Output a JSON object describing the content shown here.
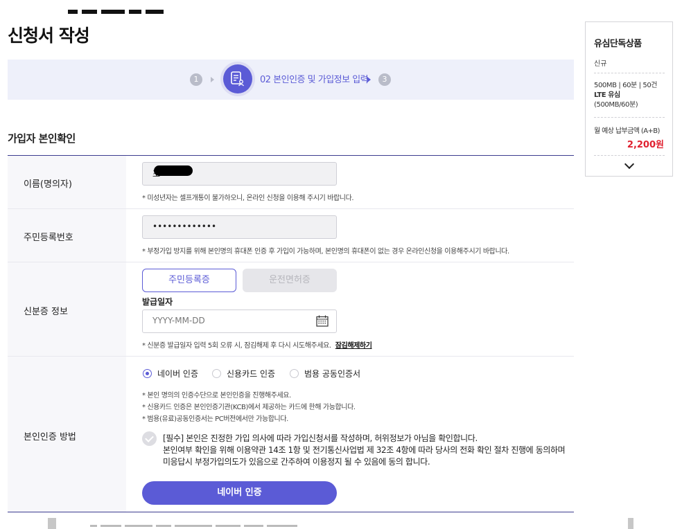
{
  "page": {
    "title": "신청서 작성"
  },
  "steps": {
    "step1": "1",
    "current_label": "02 본인인증 및 가입정보 입력",
    "step3": "3"
  },
  "section": {
    "title": "가입자 본인확인"
  },
  "rows": {
    "name": {
      "label": "이름(명의자)",
      "value": "조",
      "note": "* 미성년자는 셀프개통이 불가하오니, 온라인 신청을 이용해 주시기 바랍니다."
    },
    "rrn": {
      "label": "주민등록번호",
      "value": "•••••••••••••",
      "note": "* 부정가입 방지를 위해 본인명의 휴대폰 인증 후 가입이 가능하며, 본인명의 휴대폰이 없는 경우 온라인신청을 이용해주시기 바랍니다."
    },
    "id": {
      "label": "신분증 정보",
      "btn_resident": "주민등록증",
      "btn_license": "운전면허증",
      "issue_date_label": "발급일자",
      "issue_date_placeholder": "YYYY-MM-DD",
      "note": "* 신분증 발급일자 입력 5회 오류 시, 잠김해제 후 다시 시도해주세요.",
      "unlock_link": "잠김해제하기"
    },
    "auth": {
      "label": "본인인증 방법",
      "options": [
        "네이버 인증",
        "신용카드 인증",
        "범용 공동인증서"
      ],
      "selected_index": 0,
      "notes": [
        "* 본인 명의의 인증수단으로 본인인증을 진행해주세요.",
        "* 신용카드 인증은 본인인증기관(KCB)에서 제공하는 카드에 한해 가능합니다.",
        "* 범용(유료)공동인증서는 PC버전에서만 가능합니다."
      ],
      "agree_lines": [
        "[필수] 본인은 진정한 가입 의사에 따라 가입신청서를 작성하며, 허위정보가 아님을 확인합니다.",
        "본인여부 확인을 위해 이용약관 14조 1항 및 전기통신사업법 제 32조 4항에 따라 당사의 전화 확인 절차 진행에 동의하며",
        "미응답시 부정가입의도가 있음으로 간주하여 이용정지 될 수 있음에 동의 합니다."
      ],
      "submit_label": "네이버 인증"
    }
  },
  "sidebar": {
    "title": "유심단독상품",
    "type": "신규",
    "plan_line1": "500MB | 60분 | 50건",
    "plan_line2": "LTE 유심",
    "plan_line3": "(500MB/60분)",
    "fee_label": "월 예상 납부금액 (A+B)",
    "fee_value": "2,200원"
  },
  "colors": {
    "accent": "#5b5bd6",
    "price": "#e0202f",
    "step_bg": "#eef0fa"
  },
  "icons": {
    "step_current": "document-person-icon",
    "calendar": "calendar-icon",
    "expand": "chevron-down-icon"
  }
}
